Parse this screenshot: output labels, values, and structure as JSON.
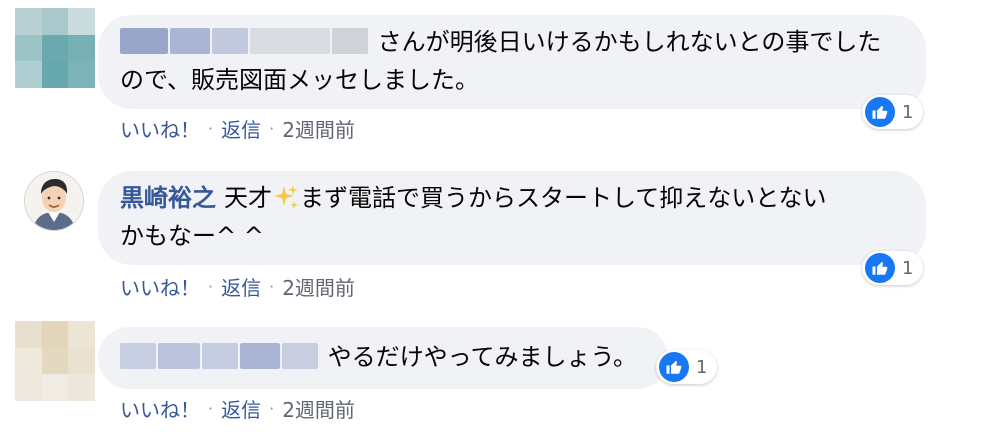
{
  "comments": [
    {
      "author": "",
      "text_line1": "さんが明後日いけるかもしれないとの事でした",
      "text_line2": "ので、販売図面メッセしました。",
      "reaction_count": "1",
      "like_label": "いいね！",
      "reply_label": "返信",
      "time": "2週間前"
    },
    {
      "author": "黒崎裕之",
      "text_line1_a": "天才",
      "text_line1_b": "まず電話で買うからスタートして抑えないとない",
      "text_line2": "かもなー^ ^",
      "reaction_count": "1",
      "like_label": "いいね！",
      "reply_label": "返信",
      "time": "2週間前"
    },
    {
      "author": "",
      "text_line1": "やるだけやってみましょう。",
      "reaction_count": "1",
      "like_label": "いいね！",
      "reply_label": "返信",
      "time": "2週間前"
    }
  ],
  "separator": "·",
  "colors": {
    "bubble_bg": "#f0f2f5",
    "link": "#385898",
    "author": "#365899",
    "like_blue": "#1877f2"
  },
  "icons": [
    "thumbs-up-icon",
    "sparkles-icon"
  ]
}
